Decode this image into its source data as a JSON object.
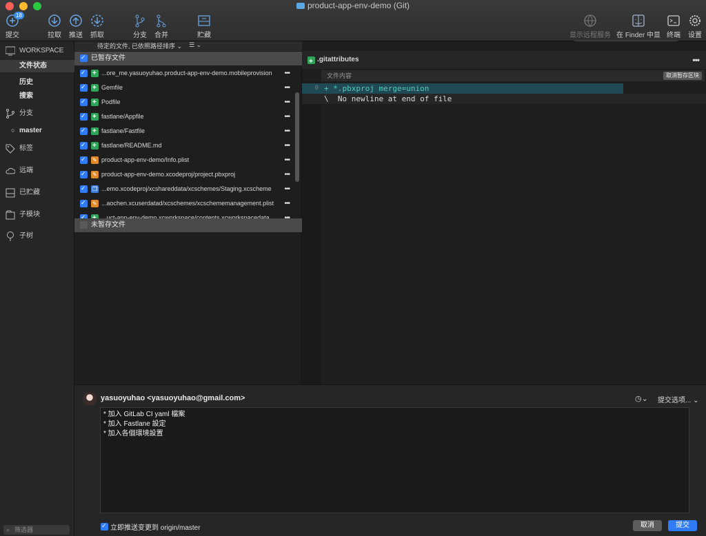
{
  "window": {
    "title": "product-app-env-demo (Git)"
  },
  "toolbar": {
    "commit": {
      "label": "提交",
      "badge": "18"
    },
    "pull": "拉取",
    "push": "推送",
    "fetch": "抓取",
    "branch": "分支",
    "merge": "合并",
    "stash": "贮藏",
    "show_remote": "显示远程服务器",
    "show_in_finder": "在 Finder 中显示",
    "terminal": "终端",
    "settings": "设置"
  },
  "sidebar": {
    "workspace": "WORKSPACE",
    "file_status": "文件状态",
    "history": "历史",
    "search": "搜索",
    "branches": "分支",
    "current_branch": "master",
    "tags": "标签",
    "remotes": "远端",
    "stashes": "已贮藏",
    "submodules": "子模块",
    "subtrees": "子树",
    "filter_placeholder": "筛选器"
  },
  "sortbar": {
    "label": "待定的文件, 已依照路径排序 ⌄",
    "view_icon": "☰ ⌄"
  },
  "staged": {
    "header": "已暂存文件",
    "files": [
      {
        "name": "...ore_me.yasuoyuhao.product-app-env-demo.mobileprovision",
        "status": "add"
      },
      {
        "name": "Gemfile",
        "status": "add"
      },
      {
        "name": "Podfile",
        "status": "add"
      },
      {
        "name": "fastlane/Appfile",
        "status": "add"
      },
      {
        "name": "fastlane/Fastfile",
        "status": "add"
      },
      {
        "name": "fastlane/README.md",
        "status": "add"
      },
      {
        "name": "product-app-env-demo/Info.plist",
        "status": "mod"
      },
      {
        "name": "product-app-env-demo.xcodeproj/project.pbxproj",
        "status": "mod"
      },
      {
        "name": "...emo.xcodeproj/xcshareddata/xcschemes/Staging.xcscheme",
        "status": "copy"
      },
      {
        "name": "...aochen.xcuserdatad/xcschemes/xcschememanagement.plist",
        "status": "mod"
      },
      {
        "name": "...uct-app-env-demo.xcworkspace/contents.xcworkspacedata",
        "status": "add"
      }
    ]
  },
  "unstaged": {
    "header": "未暂存文件"
  },
  "diff": {
    "filename": ".gitattributes",
    "hunk_label": "文件内容",
    "unstage_hunk": "取消暂存区块",
    "lines": [
      {
        "num": "0",
        "text": "+ *.pbxproj merge=union",
        "kind": "added"
      },
      {
        "num": "",
        "text": "\\  No newline at end of file",
        "kind": "meta"
      }
    ]
  },
  "search_placeholder": "搜索",
  "commit": {
    "author": "yasuoyuhao <yasuoyuhao@gmail.com>",
    "options": "提交选项... ⌄",
    "history_icon": "◷⌄",
    "message_lines": [
      "* 加入 GitLab CI yaml 檔案",
      "* 加入 Fastlane 設定",
      "* 加入各個環境設置"
    ],
    "push_label": "立即推送变更到 origin/master",
    "cancel": "取消",
    "submit": "提交"
  },
  "colors": {
    "accent": "#2f7cf6",
    "added": "#2fa55a",
    "modified": "#e08a2a"
  }
}
